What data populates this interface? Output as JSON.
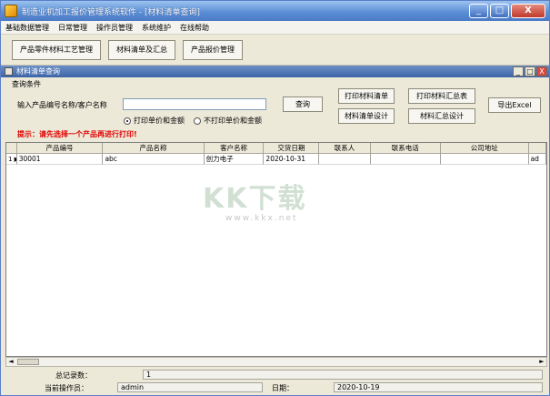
{
  "window": {
    "title": "制造业机加工报价管理系统软件 - [材料清单查询]",
    "btn_min": "_",
    "btn_max": "□",
    "btn_close": "X"
  },
  "menu": [
    "基础数据管理",
    "日常管理",
    "操作员管理",
    "系统维护",
    "在线帮助"
  ],
  "toolbar": {
    "b1": "产品零件材料工艺管理",
    "b2": "材料清单及汇总",
    "b3": "产品报价管理"
  },
  "child": {
    "title": "材料清单查询",
    "btn_min": "_",
    "btn_max": "□",
    "btn_close": "X"
  },
  "query": {
    "group_label": "查询条件",
    "label": "输入产品编号名称/客户名称",
    "input_value": "",
    "query_button": "查询",
    "print_list": "打印材料清单",
    "print_summary": "打印材料汇总表",
    "export_excel": "导出Excel",
    "design_list": "材料清单设计",
    "design_summary": "材料汇总设计",
    "radio_print": "打印单价和金额",
    "radio_noprint": "不打印单价和金额",
    "tip": "提示：请先选择一个产品再进行打印!"
  },
  "grid": {
    "headers": [
      "产品编号",
      "产品名称",
      "客户名称",
      "交货日期",
      "联系人",
      "联系电话",
      "公司地址"
    ],
    "rows": [
      {
        "indicator": "1 ▶",
        "no": "30001",
        "name": "abc",
        "customer": "创力电子",
        "date": "2020-10-31",
        "contact": "",
        "phone": "",
        "address": "",
        "extra": "ad"
      }
    ]
  },
  "scroll": {
    "left": "◄",
    "right": "►"
  },
  "status": {
    "total_label": "总记录数：",
    "total_value": "1",
    "operator_label": "当前操作员：",
    "operator_value": "admin",
    "date_label": "日期：",
    "date_value": "2020-10-19"
  },
  "watermark": {
    "main": "KK下载",
    "sub": "www.kkx.net"
  }
}
